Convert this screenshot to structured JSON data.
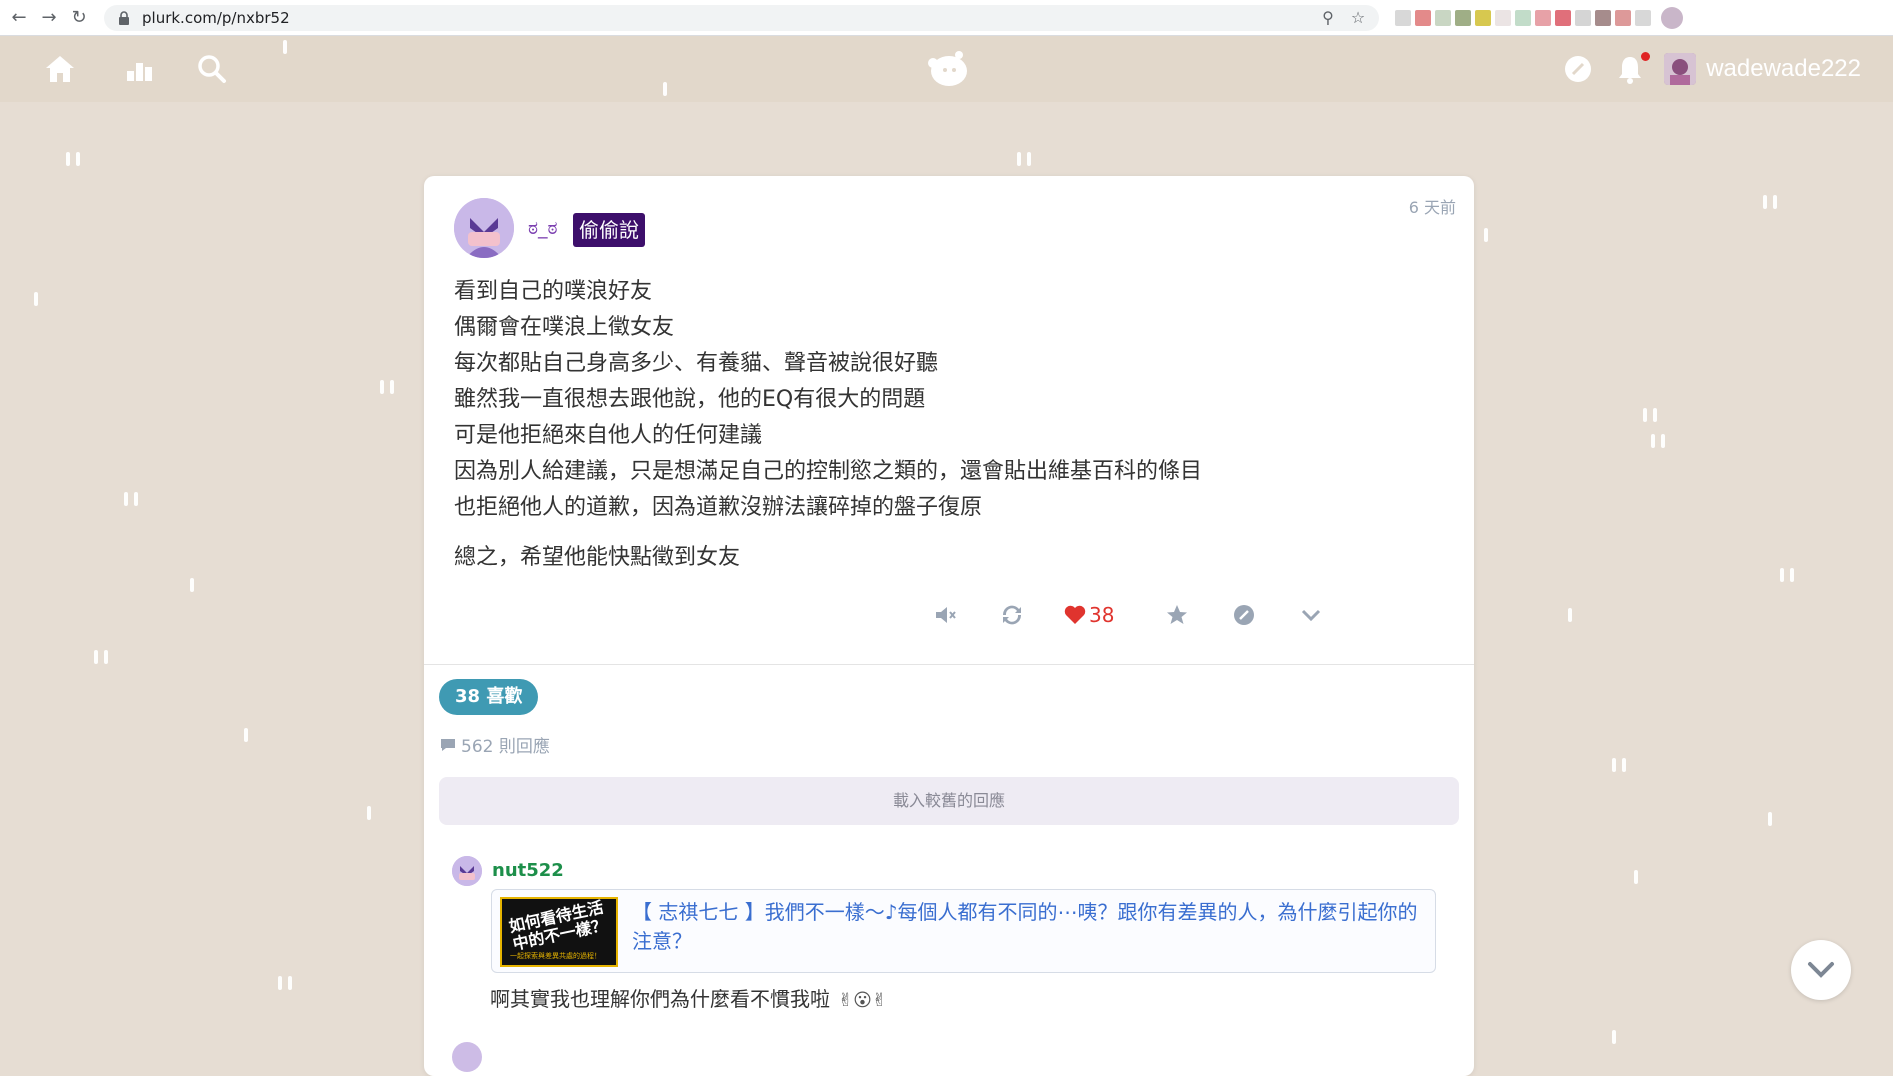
{
  "browser": {
    "url": "plurk.com/p/nxbr52"
  },
  "header": {
    "username": "wadewade222"
  },
  "post": {
    "author": "ಠ_ಠ",
    "qualifier": "偷偷說",
    "time": "6 天前",
    "lines": [
      "看到自己的噗浪好友",
      "偶爾會在噗浪上徵女友",
      "每次都貼自己身高多少、有養貓、聲音被說很好聽",
      "雖然我一直很想去跟他說，他的EQ有很大的問題",
      "可是他拒絕來自他人的任何建議",
      "因為別人給建議，只是想滿足自己的控制慾之類的，還會貼出維基百科的條目",
      "也拒絕他人的道歉，因為道歉沒辦法讓碎掉的盤子復原"
    ],
    "last_line": "總之，希望他能快點徵到女友",
    "like_count": "38"
  },
  "likes_pill": "38 喜歡",
  "responses_count": "562 則回應",
  "load_older": "載入較舊的回應",
  "response": {
    "author": "nut522",
    "link_title": "【 志祺七七 】我們不一樣～♪每個人都有不同的⋯咦？跟你有差異的人，為什麼引起你的注意？",
    "thumb_title": "如何看待生活中的不一樣？",
    "thumb_sub": "一起探索與差異共處的過程！",
    "text": "啊其實我也理解你們為什麼看不慣我啦"
  },
  "colors": {
    "background": "#e6ddd3",
    "header": "#e2d8cb",
    "qualifier": "#3d0f6b",
    "likes_pill": "#3f9ab3",
    "like_red": "#e0342e",
    "response_name": "#1d8f4a",
    "link": "#3a6ed0"
  },
  "icons": [
    "home-icon",
    "stats-icon",
    "search-icon",
    "plurk-logo-icon",
    "link-icon",
    "bell-icon",
    "mute-icon",
    "replurk-icon",
    "heart-icon",
    "star-icon",
    "share-icon",
    "chevron-down-icon",
    "comment-icon"
  ]
}
